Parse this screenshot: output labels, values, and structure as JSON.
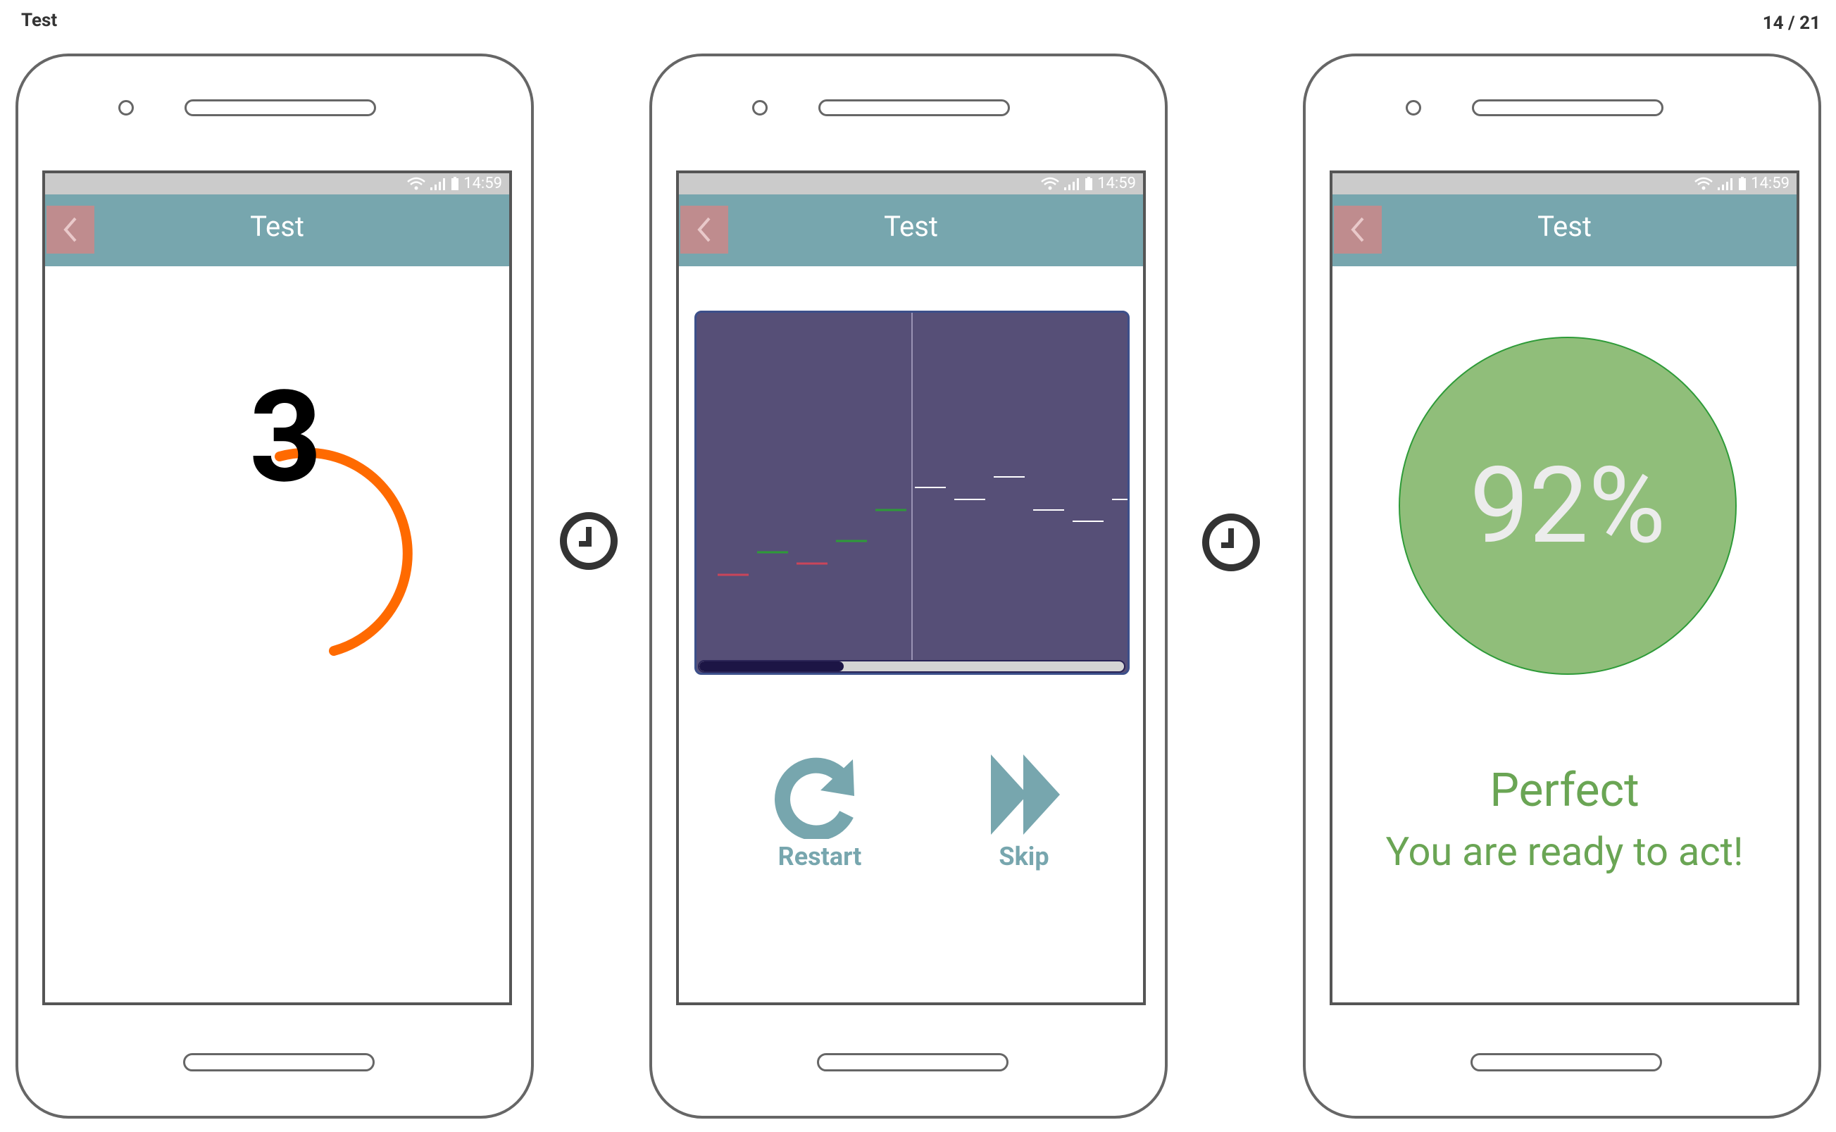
{
  "slide": {
    "title": "Test",
    "page": "14 / 21"
  },
  "status": {
    "time": "14:59"
  },
  "screens": [
    {
      "title": "Test",
      "countdown": "3"
    },
    {
      "title": "Test",
      "restart_label": "Restart",
      "skip_label": "Skip",
      "progress": 0.34
    },
    {
      "title": "Test",
      "score": "92%",
      "result_title": "Perfect",
      "result_subtitle": "You are ready to act!"
    }
  ],
  "colors": {
    "app_bar": "#77a6ae",
    "back_button": "#bf8c8e",
    "countdown_ring": "#ff6a00",
    "game_background": "#564f77",
    "score_circle": "#90be7a",
    "result_text": "#6aa554"
  },
  "icons": [
    "back-chevron-icon",
    "wifi-icon",
    "signal-icon",
    "battery-icon",
    "clock-icon",
    "restart-icon",
    "skip-icon"
  ]
}
